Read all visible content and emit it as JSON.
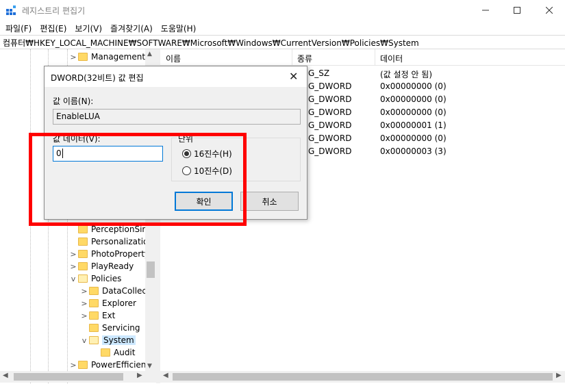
{
  "window": {
    "title": "레지스트리 편집기"
  },
  "menu": [
    "파일(F)",
    "편집(E)",
    "보기(V)",
    "즐겨찾기(A)",
    "도움말(H)"
  ],
  "address": "컴퓨터₩HKEY_LOCAL_MACHINE₩SOFTWARE₩Microsoft₩Windows₩CurrentVersion₩Policies₩System",
  "tree": [
    {
      "label": "Management",
      "chev": ">"
    },
    {
      "label": "PerceptionSim",
      "chev": ""
    },
    {
      "label": "Personalization",
      "chev": ""
    },
    {
      "label": "PhotoPropertyH",
      "chev": ">"
    },
    {
      "label": "PlayReady",
      "chev": ">"
    },
    {
      "label": "Policies",
      "chev": "v"
    },
    {
      "label": "DataCollect",
      "chev": ">"
    },
    {
      "label": "Explorer",
      "chev": ">"
    },
    {
      "label": "Ext",
      "chev": ">"
    },
    {
      "label": "Servicing",
      "chev": ""
    },
    {
      "label": "System",
      "chev": "v"
    },
    {
      "label": "Audit",
      "chev": ""
    },
    {
      "label": "PowerEfficienc",
      "chev": ">"
    }
  ],
  "list": {
    "headers": [
      "이름",
      "종류",
      "데이터"
    ],
    "rows": [
      {
        "type": "G_SZ",
        "data": "(값 설정 안 됨)"
      },
      {
        "type": "G_DWORD",
        "data": "0x00000000 (0)"
      },
      {
        "type": "G_DWORD",
        "data": "0x00000000 (0)"
      },
      {
        "type": "G_DWORD",
        "data": "0x00000000 (0)"
      },
      {
        "type": "G_DWORD",
        "data": "0x00000001 (1)"
      },
      {
        "type": "G_DWORD",
        "data": "0x00000000 (0)"
      },
      {
        "type": "G_DWORD",
        "data": "0x00000003 (3)"
      }
    ]
  },
  "dialog": {
    "title": "DWORD(32비트) 값 편집",
    "name_label": "값 이름(N):",
    "name_value": "EnableLUA",
    "data_label": "값 데이터(V):",
    "data_value": "0",
    "base_label": "단위",
    "hex_label": "16진수(H)",
    "dec_label": "10진수(D)",
    "selected_base": "hex",
    "ok_label": "확인",
    "cancel_label": "취소"
  },
  "highlight_color": "#ff0000",
  "accent_color": "#0078d7"
}
